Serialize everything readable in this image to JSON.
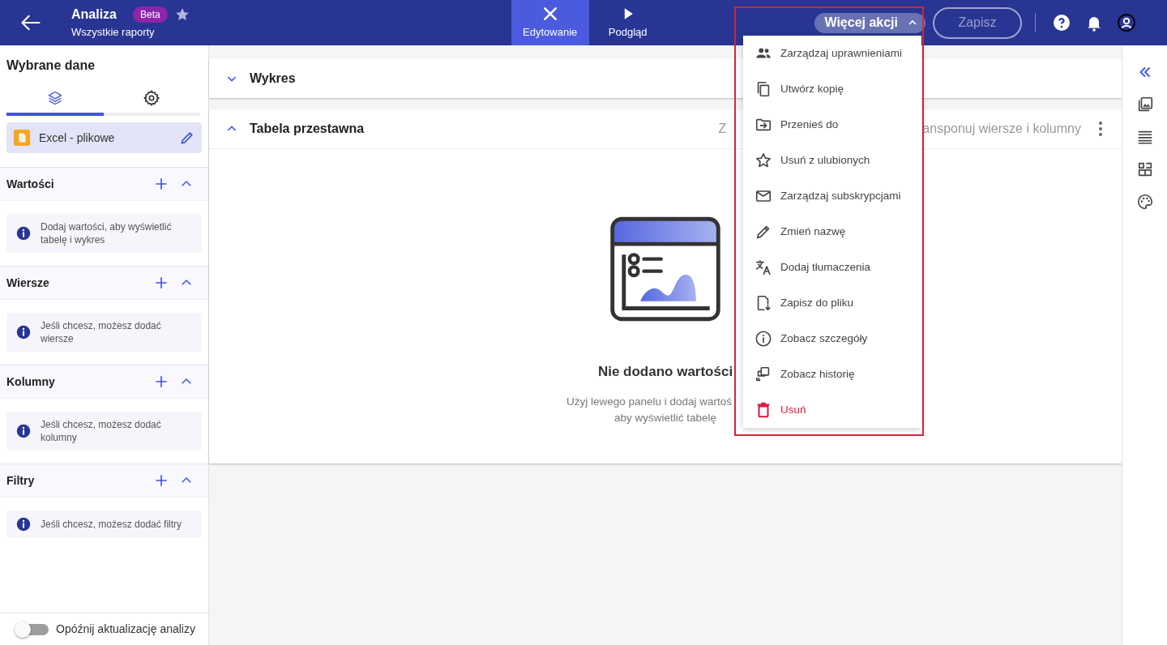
{
  "header": {
    "title": "Analiza",
    "badge": "Beta",
    "favorite": false,
    "subtitle": "Wszystkie raporty"
  },
  "mode_tabs": [
    {
      "label": "Edytowanie",
      "selected": true
    },
    {
      "label": "Podgląd",
      "selected": false
    }
  ],
  "actions": {
    "more_label": "Więcej akcji",
    "expanded": true,
    "save_label": "Zapisz",
    "save_disabled": true
  },
  "more_menu": [
    {
      "label": "Zarządzaj uprawnieniami",
      "kind": "normal"
    },
    {
      "label": "Utwórz kopię",
      "kind": "normal"
    },
    {
      "label": "Przenieś do",
      "kind": "normal"
    },
    {
      "label": "Usuń z ulubionych",
      "kind": "normal"
    },
    {
      "label": "Zarządzaj subskrypcjami",
      "kind": "normal"
    },
    {
      "label": "Zmień nazwę",
      "kind": "normal"
    },
    {
      "label": "Dodaj tłumaczenia",
      "kind": "normal"
    },
    {
      "label": "Zapisz do pliku",
      "kind": "normal"
    },
    {
      "label": "Zobacz szczegóły",
      "kind": "normal"
    },
    {
      "label": "Zobacz historię",
      "kind": "normal"
    },
    {
      "label": "Usuń",
      "kind": "danger"
    }
  ],
  "sidebar": {
    "title": "Wybrane dane",
    "tabs": [
      {
        "selected": true
      },
      {
        "selected": false
      }
    ],
    "source": {
      "label": "Excel - plikowe"
    },
    "sections": [
      {
        "title": "Wartości",
        "expanded": true,
        "hint": "Dodaj wartości, aby wyświetlić tabelę i wykres"
      },
      {
        "title": "Wiersze",
        "expanded": true,
        "hint": "Jeśli chcesz, możesz dodać wiersze"
      },
      {
        "title": "Kolumny",
        "expanded": true,
        "hint": "Jeśli chcesz, możesz dodać kolumny"
      },
      {
        "title": "Filtry",
        "expanded": true,
        "hint": "Jeśli chcesz, możesz dodać filtry"
      }
    ],
    "delay_toggle": {
      "label": "Opóźnij aktualizację analizy",
      "on": false
    }
  },
  "panels": [
    {
      "title": "Wykres",
      "expanded": false
    },
    {
      "title": "Tabela przestawna",
      "expanded": true,
      "header_texts": [
        "Z",
        "ansponuj wiersze i kolumny"
      ],
      "empty_title": "Nie dodano wartości",
      "empty_lines": [
        "Użyj lewego panelu i dodaj wartoś",
        "aby wyświetlić tabelę"
      ]
    }
  ]
}
